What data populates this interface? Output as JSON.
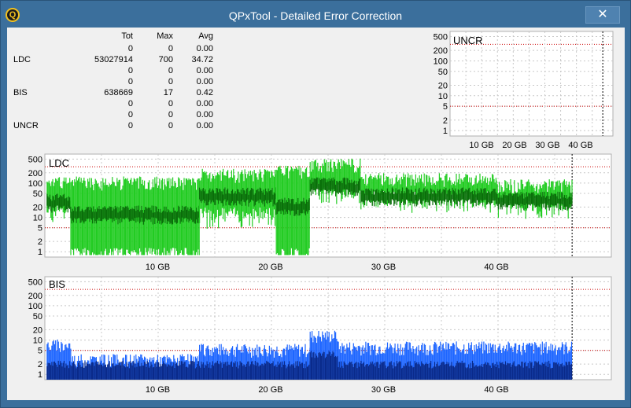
{
  "window": {
    "title": "QPxTool - Detailed Error Correction",
    "close_label": "✕",
    "app_icon": "Q"
  },
  "stats": {
    "headers": [
      "Tot",
      "Max",
      "Avg"
    ],
    "rows": [
      {
        "label": "",
        "tot": "0",
        "max": "0",
        "avg": "0.00"
      },
      {
        "label": "LDC",
        "tot": "53027914",
        "max": "700",
        "avg": "34.72"
      },
      {
        "label": "",
        "tot": "0",
        "max": "0",
        "avg": "0.00"
      },
      {
        "label": "",
        "tot": "0",
        "max": "0",
        "avg": "0.00"
      },
      {
        "label": "BIS",
        "tot": "638669",
        "max": "17",
        "avg": "0.42"
      },
      {
        "label": "",
        "tot": "0",
        "max": "0",
        "avg": "0.00"
      },
      {
        "label": "",
        "tot": "0",
        "max": "0",
        "avg": "0.00"
      },
      {
        "label": "UNCR",
        "tot": "0",
        "max": "0",
        "avg": "0.00"
      }
    ]
  },
  "chart_data": [
    {
      "type": "bar",
      "title": "UNCR",
      "scale": "log",
      "y_ticks": [
        1,
        2,
        5,
        10,
        20,
        50,
        100,
        200,
        500
      ],
      "x_ticks": [
        "10 GB",
        "20 GB",
        "30 GB",
        "40 GB"
      ],
      "x_range": [
        0,
        47
      ],
      "colors": {
        "bars": "#00cc00",
        "limit_line": "#cc0000"
      },
      "values": []
    },
    {
      "type": "area",
      "title": "LDC",
      "scale": "log",
      "y_ticks": [
        1,
        2,
        5,
        10,
        20,
        50,
        100,
        200,
        500
      ],
      "x_ticks": [
        "10 GB",
        "20 GB",
        "30 GB",
        "40 GB"
      ],
      "x_range": [
        0,
        47
      ],
      "colors": {
        "max": "#22cc22",
        "avg": "#0a6e0a",
        "limit_line": "#cc0000"
      },
      "segments_gb": [
        {
          "x0": 0.2,
          "x1": 2.3,
          "max": 120,
          "avg": 40,
          "min": 20
        },
        {
          "x0": 2.3,
          "x1": 13.7,
          "max": 120,
          "avg": 18,
          "min": 1
        },
        {
          "x0": 13.7,
          "x1": 20.5,
          "max": 200,
          "avg": 60,
          "min": 15
        },
        {
          "x0": 20.5,
          "x1": 23.5,
          "max": 250,
          "avg": 30,
          "min": 1
        },
        {
          "x0": 23.5,
          "x1": 28,
          "max": 400,
          "avg": 120,
          "min": 80
        },
        {
          "x0": 28,
          "x1": 40,
          "max": 150,
          "avg": 60,
          "min": 45
        },
        {
          "x0": 40,
          "x1": 46.7,
          "max": 100,
          "avg": 45,
          "min": 30
        }
      ]
    },
    {
      "type": "bar",
      "title": "BIS",
      "scale": "log",
      "y_ticks": [
        1,
        2,
        5,
        10,
        20,
        50,
        100,
        200,
        500
      ],
      "x_ticks": [
        "10 GB",
        "20 GB",
        "30 GB",
        "40 GB"
      ],
      "x_range": [
        0,
        47
      ],
      "colors": {
        "max": "#1e66ff",
        "avg": "#0a2a8a",
        "limit_line": "#cc0000"
      },
      "segments_gb": [
        {
          "x0": 0.2,
          "x1": 2.3,
          "max": 8,
          "avg": 2
        },
        {
          "x0": 2.3,
          "x1": 13.7,
          "max": 3,
          "avg": 2
        },
        {
          "x0": 13.7,
          "x1": 23.5,
          "max": 6,
          "avg": 2
        },
        {
          "x0": 23.5,
          "x1": 26,
          "max": 15,
          "avg": 4
        },
        {
          "x0": 26,
          "x1": 46.7,
          "max": 7,
          "avg": 2
        }
      ]
    }
  ]
}
